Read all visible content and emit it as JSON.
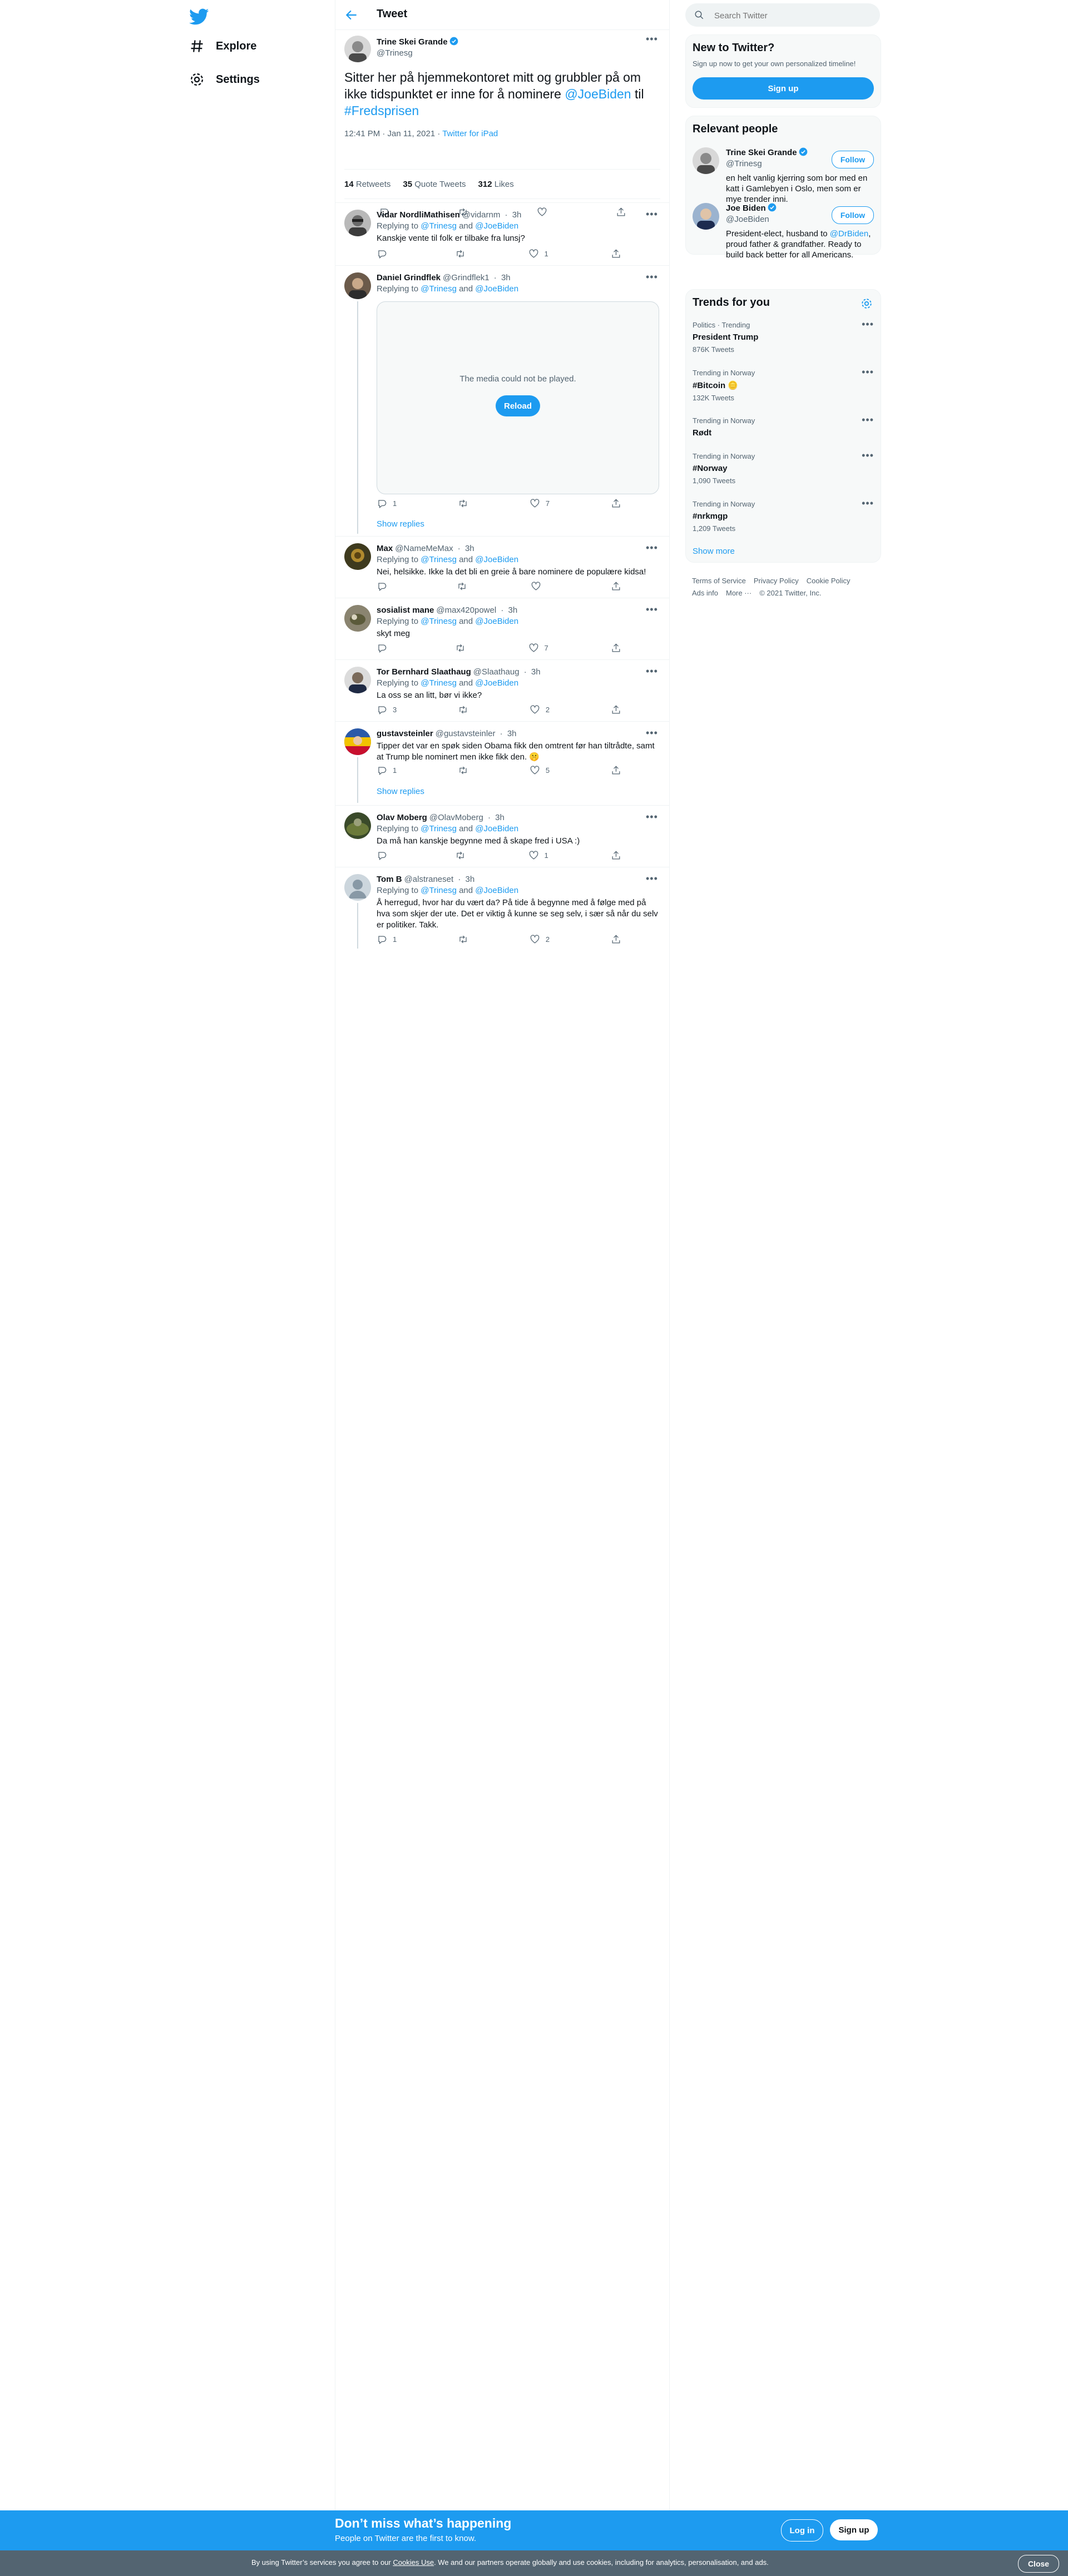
{
  "nav": {
    "explore_label": "Explore",
    "settings_label": "Settings"
  },
  "header": {
    "title": "Tweet"
  },
  "main_tweet": {
    "author_name": "Trine Skei Grande",
    "author_handle": "@Trinesg",
    "text_before": "Sitter her på hjemmekontoret mitt og grubbler på om ikke tidspunktet er inne for å nominere ",
    "mention": "@JoeBiden",
    "text_middle": " til ",
    "hashtag": "#Fredsprisen",
    "time": "12:41 PM · Jan 11, 2021",
    "source": "Twitter for iPad",
    "retweets_count": "14",
    "retweets_label": "Retweets",
    "quotes_count": "35",
    "quotes_label": "Quote Tweets",
    "likes_count": "312",
    "likes_label": "Likes"
  },
  "replies": [
    {
      "name": "Vidar NordliMathisen",
      "handle": "@vidarnm",
      "time": "3h",
      "replying_prefix": "Replying to ",
      "reply_a": "@Trinesg",
      "reply_and": " and ",
      "reply_b": "@JoeBiden",
      "text": "Kanskje vente til folk er tilbake fra lunsj?",
      "replies": "",
      "likes": "1"
    },
    {
      "name": "Daniel Grindflek",
      "handle": "@Grindflek1",
      "time": "3h",
      "replying_prefix": "Replying to ",
      "reply_a": "@Trinesg",
      "reply_and": " and ",
      "reply_b": "@JoeBiden",
      "media_message": "The media could not be played.",
      "reload_label": "Reload",
      "replies": "1",
      "likes": "7",
      "show_replies": "Show replies"
    },
    {
      "name": "Max",
      "handle": "@NameMeMax",
      "time": "3h",
      "replying_prefix": "Replying to ",
      "reply_a": "@Trinesg",
      "reply_and": " and ",
      "reply_b": "@JoeBiden",
      "text": "Nei, helsikke. Ikke la det bli en greie å bare nominere de populære kidsa!",
      "replies": "",
      "likes": ""
    },
    {
      "name": "sosialist mane",
      "handle": "@max420powel",
      "time": "3h",
      "replying_prefix": "Replying to ",
      "reply_a": "@Trinesg",
      "reply_and": " and ",
      "reply_b": "@JoeBiden",
      "text": "skyt meg",
      "replies": "",
      "likes": "7"
    },
    {
      "name": "Tor Bernhard Slaathaug",
      "handle": "@Slaathaug",
      "time": "3h",
      "replying_prefix": "Replying to ",
      "reply_a": "@Trinesg",
      "reply_and": " and ",
      "reply_b": "@JoeBiden",
      "text": "La oss se an litt, bør vi ikke?",
      "replies": "3",
      "likes": "2"
    },
    {
      "name": "gustavsteinler",
      "handle": "@gustavsteinler",
      "time": "3h",
      "text": "Tipper det var en spøk siden Obama fikk den omtrent før han tiltrådte, samt at Trump ble nominert men ikke fikk den. 🤫",
      "replies": "1",
      "likes": "5",
      "show_replies": "Show replies"
    },
    {
      "name": "Olav Moberg",
      "handle": "@OlavMoberg",
      "time": "3h",
      "replying_prefix": "Replying to ",
      "reply_a": "@Trinesg",
      "reply_and": " and ",
      "reply_b": "@JoeBiden",
      "text": "Da må han kanskje begynne med å skape fred i USA :)",
      "replies": "",
      "likes": "1"
    },
    {
      "name": "Tom B",
      "handle": "@alstraneset",
      "time": "3h",
      "replying_prefix": "Replying to ",
      "reply_a": "@Trinesg",
      "reply_and": " and ",
      "reply_b": "@JoeBiden",
      "text": "Å herregud, hvor har du vært da? På tide å begynne med å følge med på hva som skjer der ute. Det er viktig å kunne se seg selv, i sær så når du selv er politiker. Takk.",
      "replies": "1",
      "likes": "2"
    }
  ],
  "right": {
    "search_placeholder": "Search Twitter",
    "new_title": "New to Twitter?",
    "new_sub": "Sign up now to get your own personalized timeline!",
    "signup_label": "Sign up",
    "relevant_title": "Relevant people",
    "follow_label": "Follow",
    "people": [
      {
        "name": "Trine Skei Grande",
        "handle": "@Trinesg",
        "bio": "en helt vanlig kjerring som bor med en katt i Gamlebyen i Oslo, men som er mye trender inni."
      },
      {
        "name": "Joe Biden",
        "handle": "@JoeBiden",
        "bio_before": "President-elect, husband to ",
        "bio_mention": "@DrBiden",
        "bio_after": ", proud father & grandfather. Ready to build back better for all Americans."
      }
    ],
    "trends_title": "Trends for you",
    "trends": [
      {
        "category": "Politics · Trending",
        "name": "President Trump",
        "count": "876K Tweets"
      },
      {
        "category": "Trending in Norway",
        "name": "#Bitcoin 🪙",
        "count": "132K Tweets"
      },
      {
        "category": "Trending in Norway",
        "name": "Rødt",
        "count": ""
      },
      {
        "category": "Trending in Norway",
        "name": "#Norway",
        "count": "1,090 Tweets"
      },
      {
        "category": "Trending in Norway",
        "name": "#nrkmgp",
        "count": "1,209 Tweets"
      }
    ],
    "show_more": "Show more",
    "footer": [
      "Terms of Service",
      "Privacy Policy",
      "Cookie Policy",
      "Ads info",
      "More ···",
      "© 2021 Twitter, Inc."
    ]
  },
  "banner": {
    "title": "Don’t miss what’s happening",
    "subtitle": "People on Twitter are the first to know.",
    "login_label": "Log in",
    "signup_label": "Sign up"
  },
  "cookie": {
    "text_before": "By using Twitter’s services you agree to our ",
    "link": "Cookies Use",
    "text_after": ". We and our partners operate globally and use cookies, including for analytics, personalisation, and ads.",
    "close_label": "Close"
  },
  "colors": {
    "accent": "#1d9bf0",
    "muted": "#536471",
    "border": "#eff3f4"
  }
}
